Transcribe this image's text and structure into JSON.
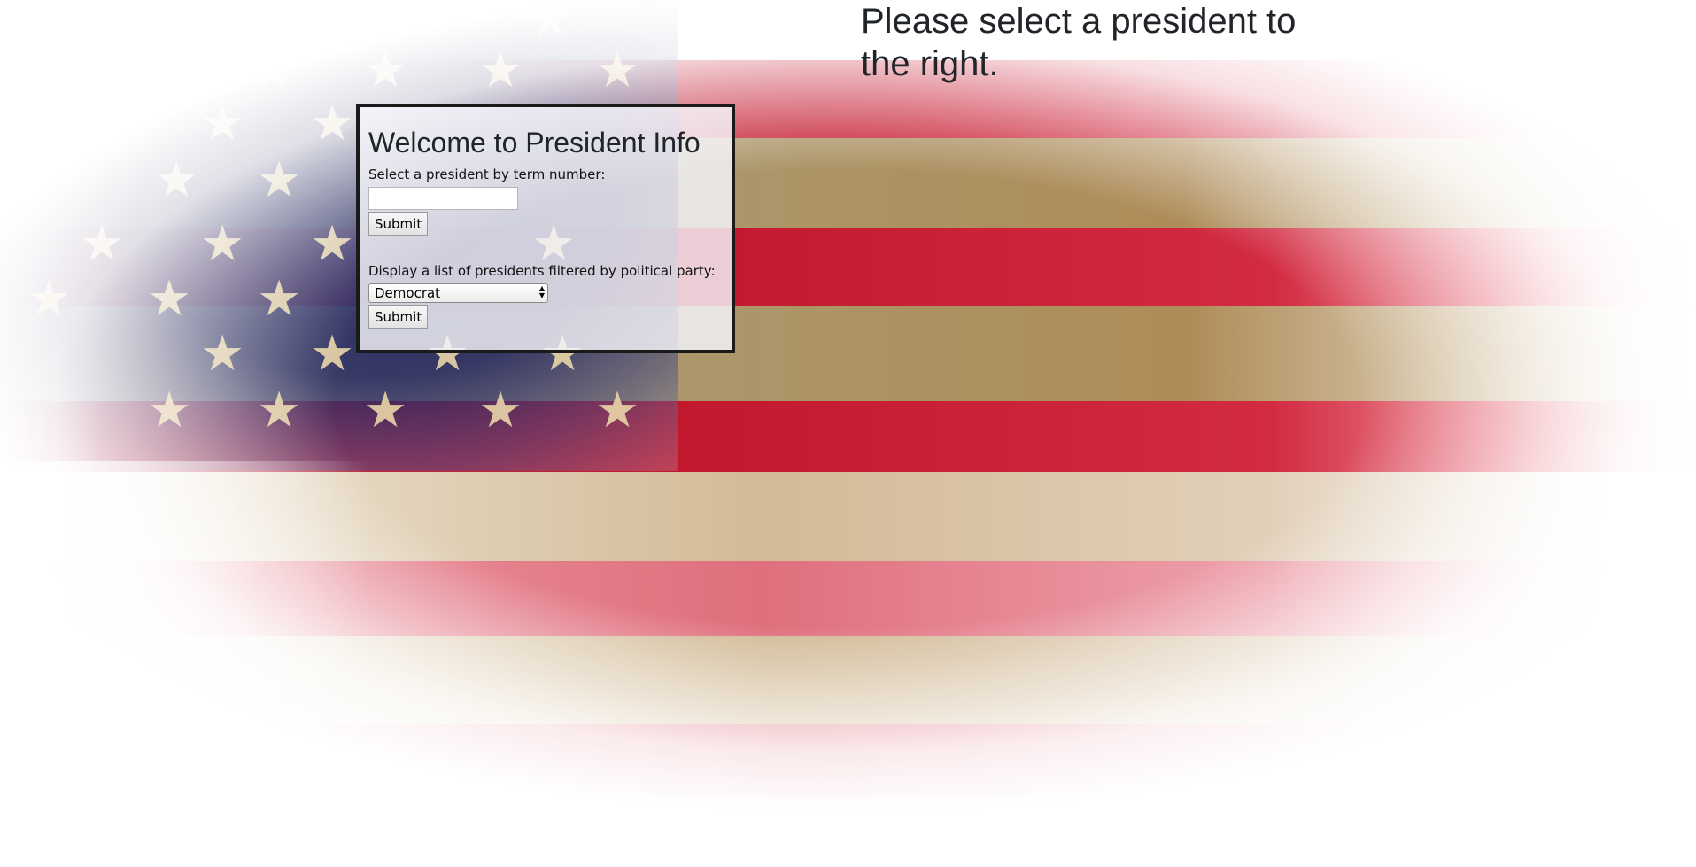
{
  "page": {
    "prompt_heading": "Please select a president to the right."
  },
  "form_panel": {
    "title": "Welcome to President Info",
    "term_label": "Select a president by term number:",
    "term_value": "",
    "term_submit_label": "Submit",
    "party_label": "Display a list of presidents filtered by political party:",
    "party_selected": "Democrat",
    "party_submit_label": "Submit"
  },
  "background": {
    "description_icon": "american-flag-grunge",
    "colors": {
      "red": "#c41026",
      "blue": "#1e2360",
      "tan": "#b09060",
      "star": "#e9d6a8"
    }
  },
  "colors": {
    "text": "#212529",
    "panel_border": "#1a1a1a",
    "panel_bg": "#f5f5fa"
  }
}
